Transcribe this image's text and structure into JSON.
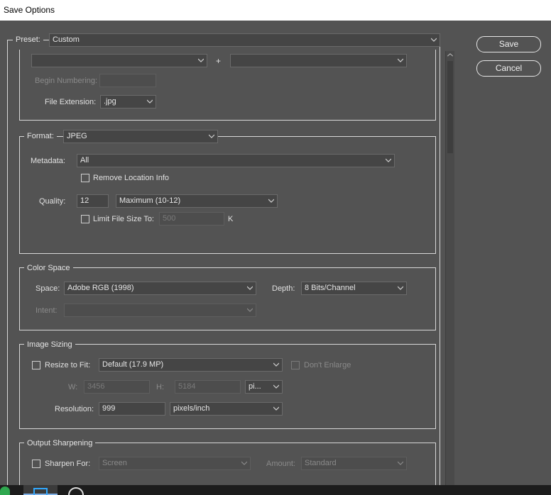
{
  "window": {
    "title": "Save Options"
  },
  "buttons": {
    "save": "Save",
    "cancel": "Cancel"
  },
  "preset": {
    "label": "Preset:",
    "value": "Custom"
  },
  "naming": {
    "plus": "+",
    "begin_numbering_label": "Begin Numbering:",
    "file_extension_label": "File Extension:",
    "file_extension_value": ".jpg"
  },
  "format": {
    "label": "Format:",
    "value": "JPEG",
    "metadata_label": "Metadata:",
    "metadata_value": "All",
    "remove_location_label": "Remove Location Info",
    "quality_label": "Quality:",
    "quality_value": "12",
    "quality_preset": "Maximum  (10-12)",
    "limit_size_label": "Limit File Size To:",
    "limit_size_value": "500",
    "limit_size_unit": "K"
  },
  "color_space": {
    "title": "Color Space",
    "space_label": "Space:",
    "space_value": "Adobe RGB (1998)",
    "depth_label": "Depth:",
    "depth_value": "8 Bits/Channel",
    "intent_label": "Intent:"
  },
  "image_sizing": {
    "title": "Image Sizing",
    "resize_label": "Resize to Fit:",
    "resize_value": "Default  (17.9 MP)",
    "dont_enlarge_label": "Don't Enlarge",
    "w_label": "W:",
    "w_value": "3456",
    "h_label": "H:",
    "h_value": "5184",
    "unit_value": "pi...",
    "resolution_label": "Resolution:",
    "resolution_value": "999",
    "resolution_unit": "pixels/inch"
  },
  "output_sharpening": {
    "title": "Output Sharpening",
    "sharpen_label": "Sharpen For:",
    "sharpen_value": "Screen",
    "amount_label": "Amount:",
    "amount_value": "Standard"
  }
}
